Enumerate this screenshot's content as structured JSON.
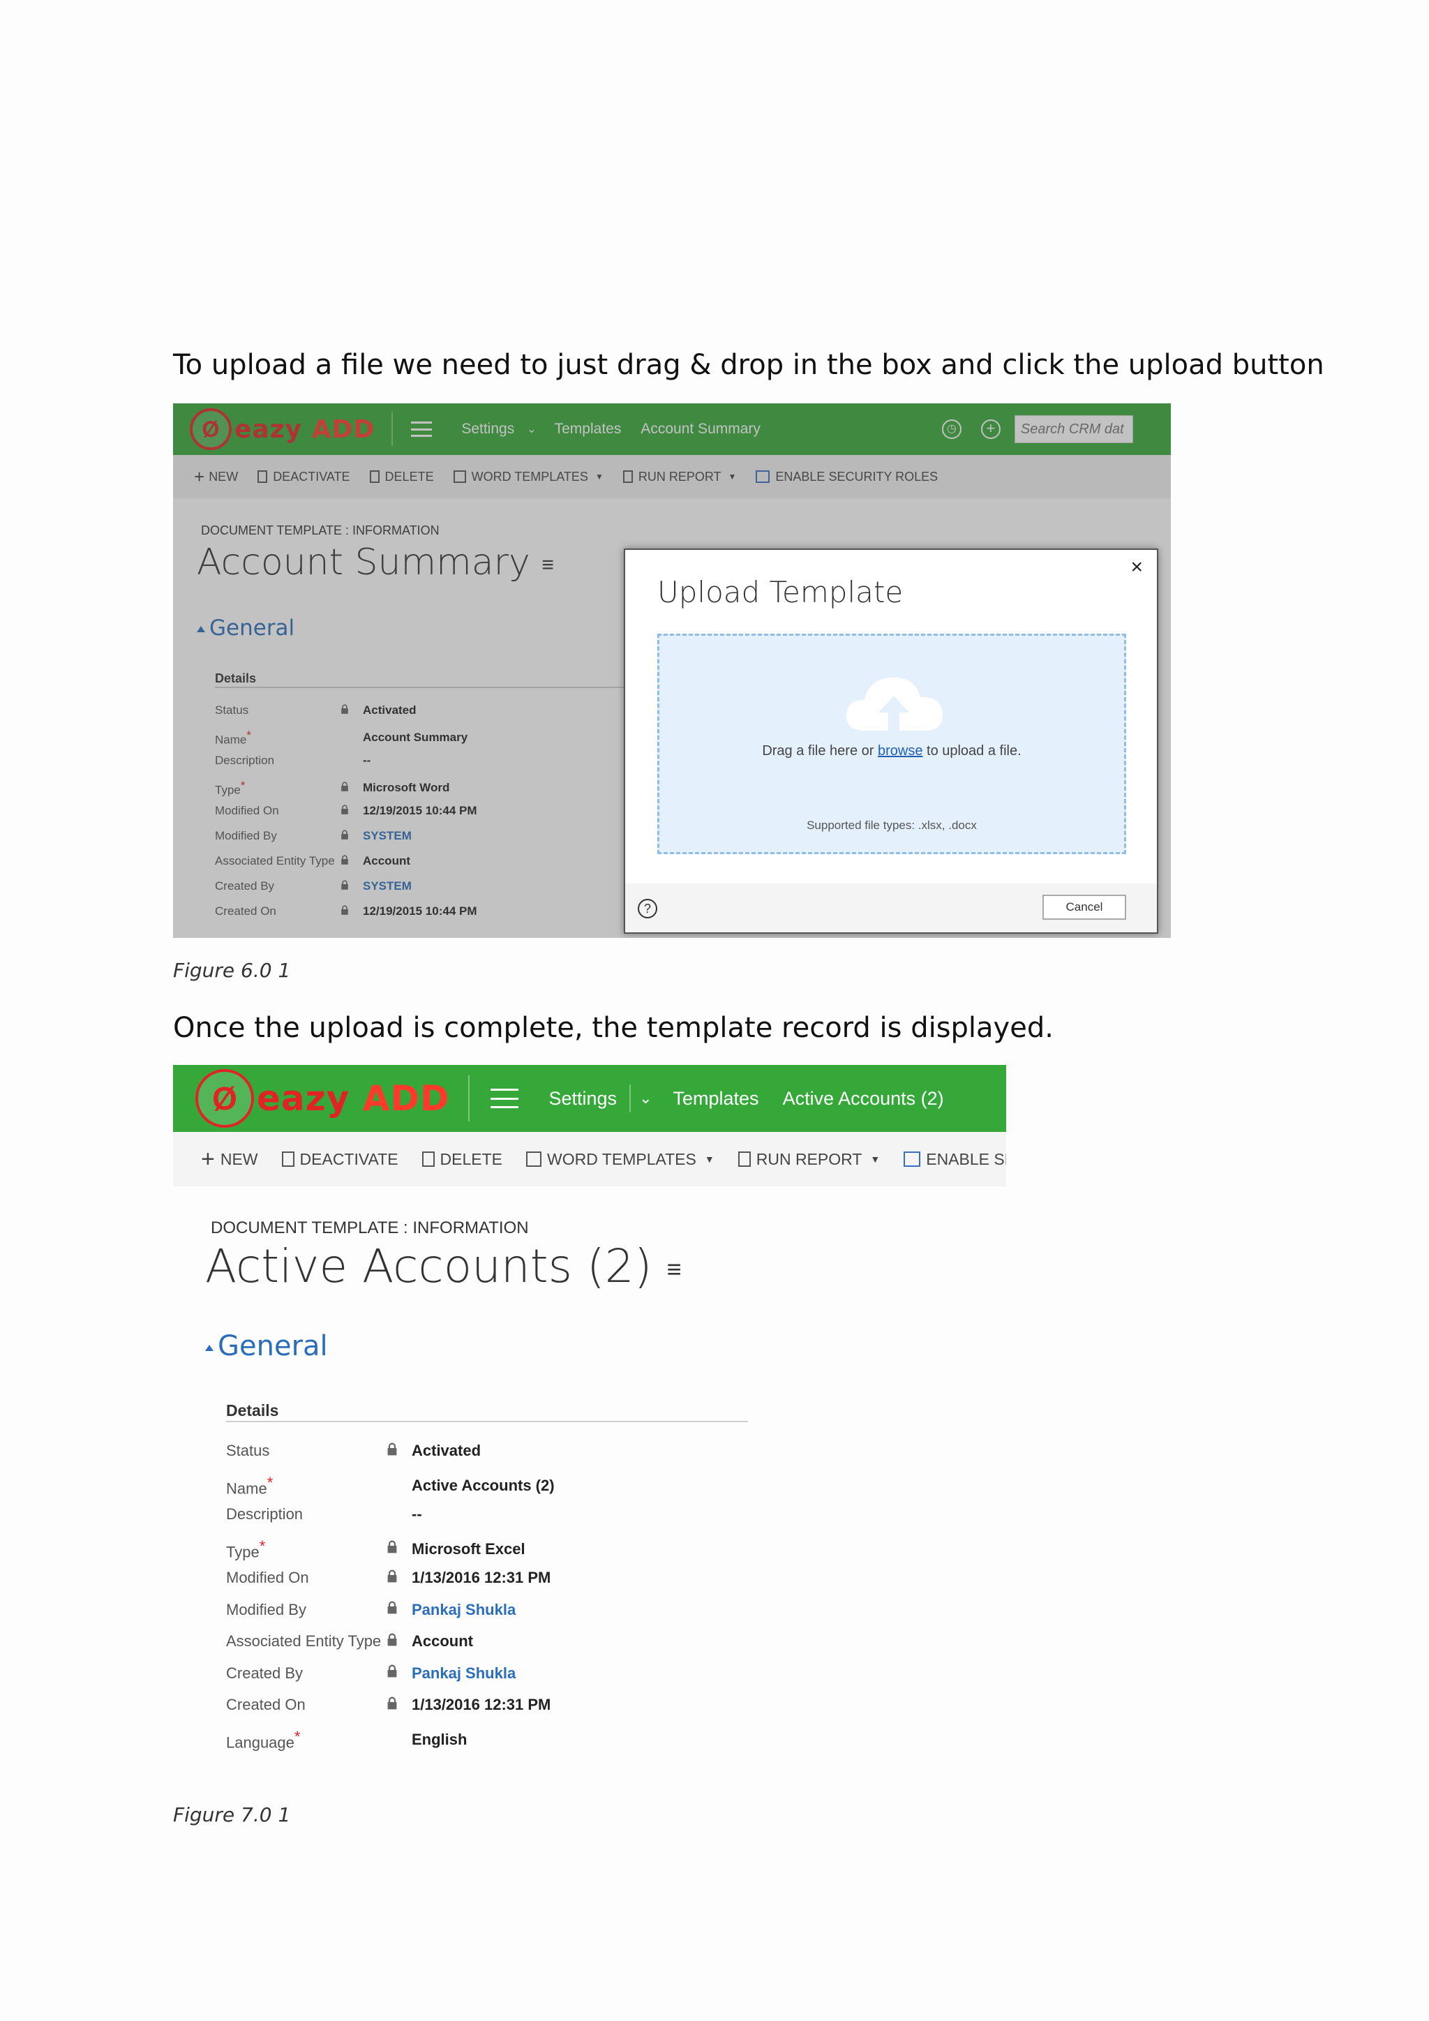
{
  "intro_text": "To upload a file we need to just drag & drop in the box and click the upload button",
  "after_text": "Once the upload is complete, the template record is displayed.",
  "figure1": {
    "caption": "Figure 6.0 1",
    "logo": {
      "eazy": "eazy",
      "add": "ADD"
    },
    "nav": {
      "settings": "Settings",
      "templates": "Templates",
      "current": "Account Summary",
      "search_placeholder": "Search CRM dat"
    },
    "toolbar": [
      "NEW",
      "DEACTIVATE",
      "DELETE",
      "WORD TEMPLATES",
      "RUN REPORT",
      "ENABLE SECURITY ROLES"
    ],
    "section_label": "DOCUMENT TEMPLATE : INFORMATION",
    "record_title": "Account Summary",
    "general": "General",
    "details": "Details",
    "fields": [
      {
        "label": "Status",
        "value": "Activated"
      },
      {
        "label": "Name",
        "value": "Account Summary"
      },
      {
        "label": "Description",
        "value": "--"
      },
      {
        "label": "Type",
        "value": "Microsoft Word"
      },
      {
        "label": "Modified On",
        "value": "12/19/2015   10:44 PM"
      },
      {
        "label": "Modified By",
        "value": "SYSTEM"
      },
      {
        "label": "Associated Entity Type",
        "value": "Account"
      },
      {
        "label": "Created By",
        "value": "SYSTEM"
      },
      {
        "label": "Created On",
        "value": "12/19/2015   10:44 PM"
      }
    ],
    "dialog": {
      "title": "Upload Template",
      "close": "×",
      "drop_before": "Drag a file here or ",
      "browse": "browse",
      "drop_after": " to upload a file.",
      "supported": "Supported file types: .xlsx, .docx",
      "help": "?",
      "cancel": "Cancel"
    }
  },
  "figure2": {
    "caption": "Figure 7.0 1",
    "logo": {
      "eazy": "eazy",
      "add": "ADD"
    },
    "nav": {
      "settings": "Settings",
      "templates": "Templates",
      "current": "Active Accounts (2)"
    },
    "toolbar": [
      "NEW",
      "DEACTIVATE",
      "DELETE",
      "WORD TEMPLATES",
      "RUN REPORT",
      "ENABLE SEC"
    ],
    "section_label": "DOCUMENT TEMPLATE : INFORMATION",
    "record_title": "Active Accounts (2)",
    "general": "General",
    "details": "Details",
    "fields": [
      {
        "label": "Status",
        "value": "Activated"
      },
      {
        "label": "Name",
        "value": "Active Accounts (2)"
      },
      {
        "label": "Description",
        "value": "--"
      },
      {
        "label": "Type",
        "value": "Microsoft Excel"
      },
      {
        "label": "Modified On",
        "value": "1/13/2016   12:31 PM"
      },
      {
        "label": "Modified By",
        "value": "Pankaj Shukla"
      },
      {
        "label": "Associated Entity Type",
        "value": "Account"
      },
      {
        "label": "Created By",
        "value": "Pankaj Shukla"
      },
      {
        "label": "Created On",
        "value": "1/13/2016   12:31 PM"
      },
      {
        "label": "Language",
        "value": "English"
      }
    ]
  },
  "colors": {
    "nav_green": "#36a83a",
    "logo_red": "#e02424",
    "link_blue": "#2a6ebb",
    "dropzone": "#e4f1fc"
  }
}
